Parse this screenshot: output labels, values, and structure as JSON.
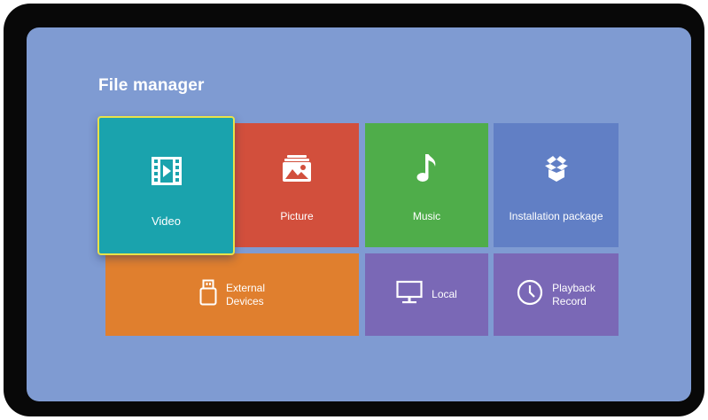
{
  "page": {
    "title": "File manager"
  },
  "tiles": {
    "video": {
      "label": "Video",
      "icon": "film-play-icon",
      "color": "#1aa3ad",
      "selected": true,
      "focus_color": "#e8e34a"
    },
    "picture": {
      "label": "Picture",
      "icon": "image-icon",
      "color": "#d24f3c"
    },
    "music": {
      "label": "Music",
      "icon": "music-note-icon",
      "color": "#4fad4a"
    },
    "installation": {
      "label": "Installation package",
      "icon": "package-icon",
      "color": "#617fc5"
    },
    "external": {
      "label_line1": "External",
      "label_line2": "Devices",
      "icon": "usb-drive-icon",
      "color": "#e07f2e"
    },
    "local": {
      "label": "Local",
      "icon": "monitor-icon",
      "color": "#7a68b6"
    },
    "playback": {
      "label_line1": "Playback",
      "label_line2": "Record",
      "icon": "clock-icon",
      "color": "#7a68b6"
    }
  },
  "colors": {
    "background": "#7f9bd2",
    "bezel": "#080808"
  }
}
